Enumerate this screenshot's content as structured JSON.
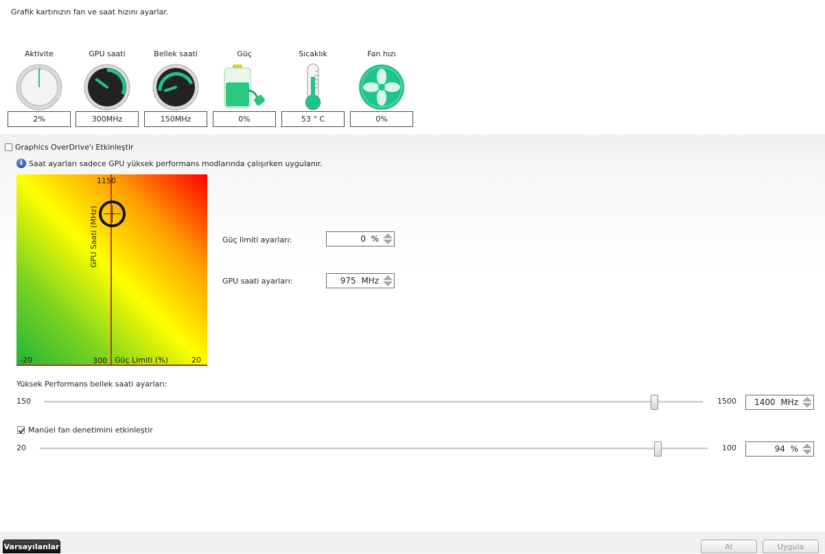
{
  "header": {
    "description": "Grafik kartınızın fan ve saat hızını ayarlar."
  },
  "monitors": [
    {
      "label": "Aktivite",
      "value": "2%",
      "icon": "activity-gauge-icon"
    },
    {
      "label": "GPU saati",
      "value": "300MHz",
      "icon": "gpu-clock-gauge-icon"
    },
    {
      "label": "Bellek saati",
      "value": "150MHz",
      "icon": "memory-clock-gauge-icon"
    },
    {
      "label": "Güç",
      "value": "0%",
      "icon": "battery-plug-icon"
    },
    {
      "label": "Sıcaklık",
      "value": "53 ° C",
      "icon": "thermometer-icon"
    },
    {
      "label": "Fan hızı",
      "value": "0%",
      "icon": "fan-icon"
    }
  ],
  "overdrive": {
    "enable_label": "Graphics OverDrive'ı Etkinleştir",
    "enabled": false,
    "info_text": "Saat ayarları sadece GPU yüksek performans modlarında çalışırken uygulanır."
  },
  "chart": {
    "y_max_label": "1150",
    "y_min_label": "300",
    "x_min_label": "-20",
    "x_max_label": "20",
    "x_axis_label": "Güç Limiti (%)",
    "y_axis_label": "GPU Saati (MHz)",
    "power_limit_percent": 0,
    "gpu_clock_mhz": 975
  },
  "settings": {
    "power_limit_label": "Güç limiti ayarları:",
    "power_limit_value": "0",
    "power_limit_unit": "%",
    "gpu_clock_label": "GPU saati ayarları:",
    "gpu_clock_value": "975",
    "gpu_clock_unit": "MHz"
  },
  "memory_clock": {
    "label": "Yüksek Performans bellek saati ayarları:",
    "min": "150",
    "max": "1500",
    "value": "1400",
    "unit": "MHz",
    "level": 0.926
  },
  "fan": {
    "enable_label": "Manüel fan denetimini etkinleştir",
    "enabled": true,
    "min": "20",
    "max": "100",
    "value": "94",
    "unit": "%",
    "level": 0.925
  },
  "footer": {
    "defaults_label": "Varsayılanlar",
    "discard_label": "At",
    "apply_label": "Uygula"
  },
  "colors": {
    "accent_green": "#1fc48a",
    "chart_line": "#c8282a",
    "dark_button": "#1a1a1a"
  }
}
